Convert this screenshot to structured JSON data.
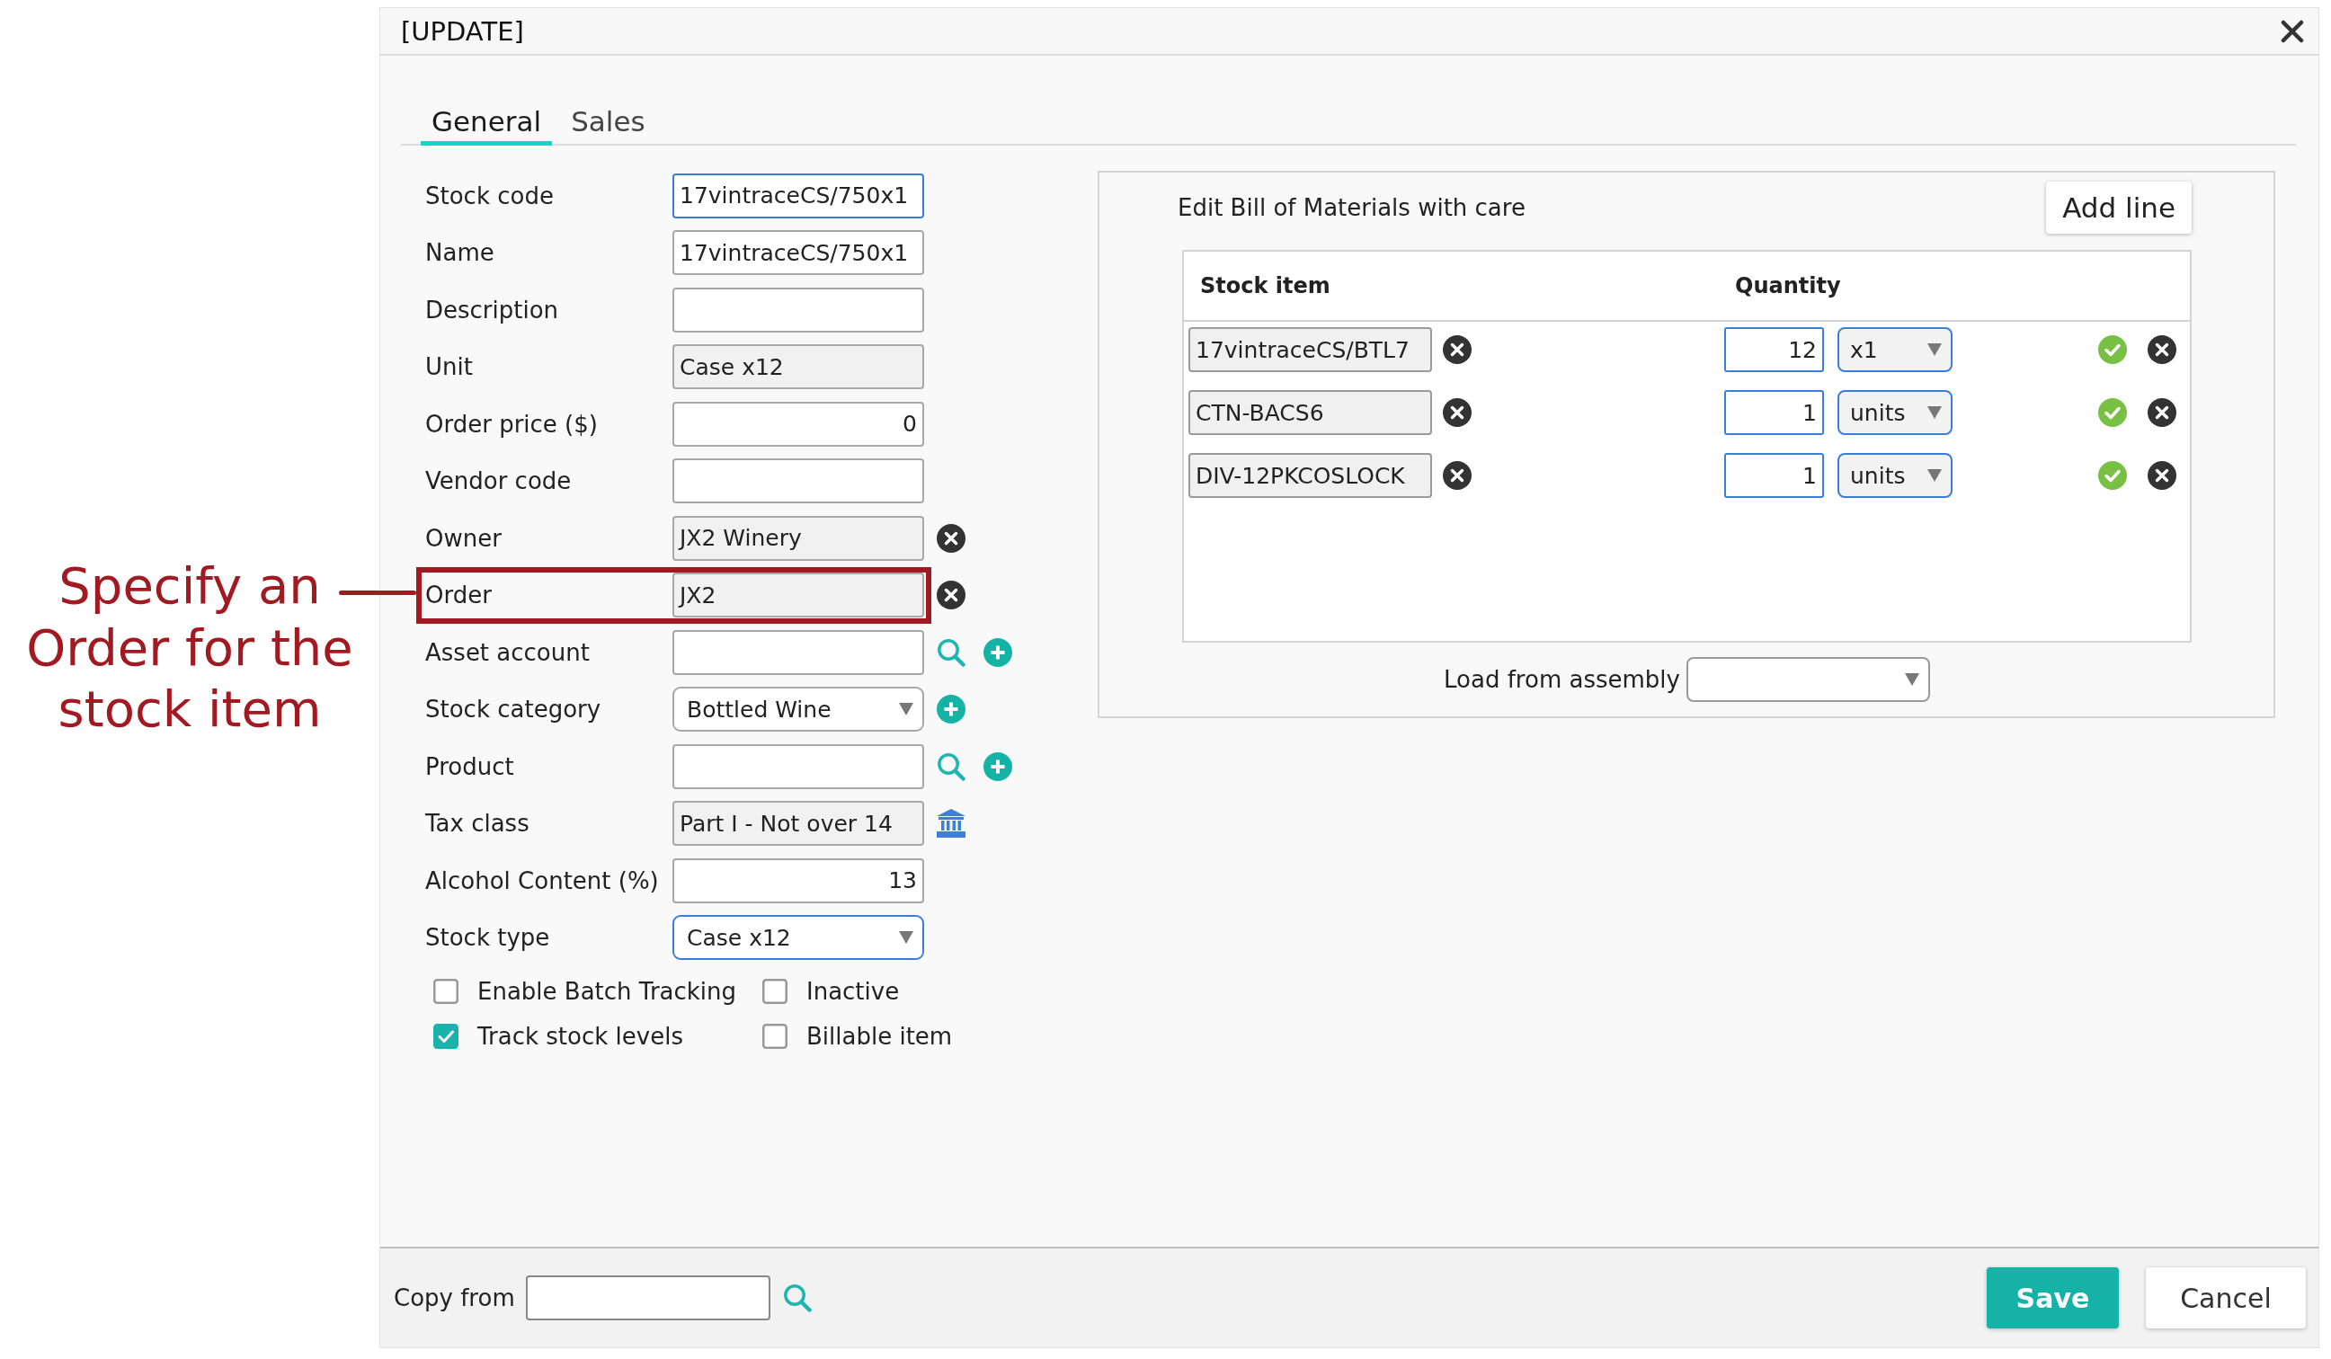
{
  "annotation": {
    "text": "Specify an\nOrder for the\nstock item"
  },
  "dialog": {
    "title": "[UPDATE]"
  },
  "tabs": [
    {
      "label": "General",
      "selected": true
    },
    {
      "label": "Sales",
      "selected": false
    }
  ],
  "form": {
    "fields": [
      {
        "label": "Stock code",
        "kind": "text",
        "value": "17vintraceCS/750x1",
        "focused": true,
        "highlighted": false
      },
      {
        "label": "Name",
        "kind": "text",
        "value": "17vintraceCS/750x1",
        "focused": false,
        "highlighted": false
      },
      {
        "label": "Description",
        "kind": "text",
        "focused": false,
        "highlighted": false
      },
      {
        "label": "Unit",
        "kind": "readonly",
        "value": "Case x12",
        "focused": false,
        "highlighted": false
      },
      {
        "label": "Order price ($)",
        "kind": "number",
        "value": "0",
        "focused": false,
        "highlighted": false
      },
      {
        "label": "Vendor code",
        "kind": "text",
        "focused": false,
        "highlighted": false
      },
      {
        "label": "Owner",
        "kind": "readonly",
        "value": "JX2 Winery",
        "focused": false,
        "highlighted": false,
        "actions": [
          {
            "kind": "clear"
          }
        ]
      },
      {
        "label": "Order",
        "kind": "readonly",
        "value": "JX2",
        "focused": false,
        "highlighted": true,
        "actions": [
          {
            "kind": "clear"
          }
        ]
      },
      {
        "label": "Asset account",
        "kind": "text",
        "focused": false,
        "highlighted": false,
        "actions": [
          {
            "kind": "search"
          },
          {
            "kind": "add"
          }
        ]
      },
      {
        "label": "Stock category",
        "kind": "select",
        "value": "Bottled Wine",
        "focused": false,
        "highlighted": false,
        "actions": [
          {
            "kind": "add"
          }
        ]
      },
      {
        "label": "Product",
        "kind": "text",
        "focused": false,
        "highlighted": false,
        "actions": [
          {
            "kind": "search"
          },
          {
            "kind": "add"
          }
        ]
      },
      {
        "label": "Tax class",
        "kind": "readonly",
        "value": "Part I - Not over 14",
        "focused": false,
        "highlighted": false,
        "actions": [
          {
            "kind": "tax"
          }
        ]
      },
      {
        "label": "Alcohol Content (%)",
        "kind": "number",
        "value": "13",
        "focused": false,
        "highlighted": false
      },
      {
        "label": "Stock type",
        "kind": "select",
        "value": "Case x12",
        "focused": true,
        "highlighted": false
      }
    ],
    "checkboxes": [
      {
        "label": "Enable Batch Tracking",
        "checked": false
      },
      {
        "label": "Inactive",
        "checked": false
      },
      {
        "label": "Track stock levels",
        "checked": true
      },
      {
        "label": "Billable item",
        "checked": false
      }
    ]
  },
  "bill_of_materials": {
    "title": "Edit Bill of Materials with care",
    "add_button": "Add line",
    "columns": [
      "Stock item",
      "Quantity"
    ],
    "rows": [
      {
        "stock_item": "17vintraceCS/BTL7",
        "quantity": "12",
        "unit": "x1"
      },
      {
        "stock_item": "CTN-BACS6",
        "quantity": "1",
        "unit": "units"
      },
      {
        "stock_item": "DIV-12PKCOSLOCK",
        "quantity": "1",
        "unit": "units"
      }
    ],
    "load_from_assembly": {
      "label": "Load from assembly"
    }
  },
  "footer": {
    "copy_from": {
      "label": "Copy from"
    },
    "buttons": [
      {
        "label": "Save",
        "kind": "primary"
      },
      {
        "label": "Cancel",
        "kind": "secondary"
      }
    ]
  }
}
